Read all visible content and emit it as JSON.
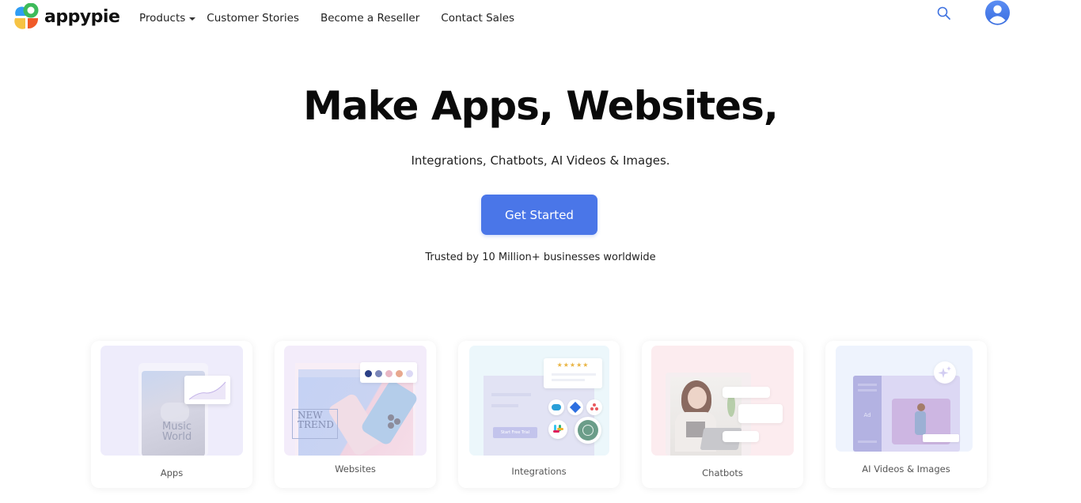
{
  "header": {
    "logo_text": "appypie",
    "nav": [
      {
        "label": "Products",
        "has_dropdown": true
      },
      {
        "label": "Customer Stories",
        "has_dropdown": false
      },
      {
        "label": "Become a Reseller",
        "has_dropdown": false
      },
      {
        "label": "Contact Sales",
        "has_dropdown": false
      }
    ],
    "icons": {
      "search": "search-icon",
      "account": "user-avatar-icon"
    }
  },
  "hero": {
    "title": "Make Apps, Websites,",
    "subtitle": "Integrations, Chatbots, AI Videos & Images.",
    "cta_label": "Get Started",
    "trusted_text": "Trusted by 10 Million+ businesses worldwide"
  },
  "products": [
    {
      "label": "Apps",
      "art_text": [
        "Music",
        "World"
      ]
    },
    {
      "label": "Websites",
      "art_text": [
        "NEW",
        "TREND"
      ],
      "swatches": [
        "#2b3f86",
        "#7a86b8",
        "#e9b7c4",
        "#e8a88e",
        "#dcd9f5"
      ]
    },
    {
      "label": "Integrations",
      "art_button": "Start Free Trial",
      "rating_stars": "★★★★★"
    },
    {
      "label": "Chatbots"
    },
    {
      "label": "AI Videos & Images",
      "art_text": [
        "Ad"
      ]
    }
  ],
  "colors": {
    "accent": "#4a76e8",
    "logo": [
      "#2f9df4",
      "#3dbb5a",
      "#f6c343",
      "#f05a28"
    ]
  }
}
